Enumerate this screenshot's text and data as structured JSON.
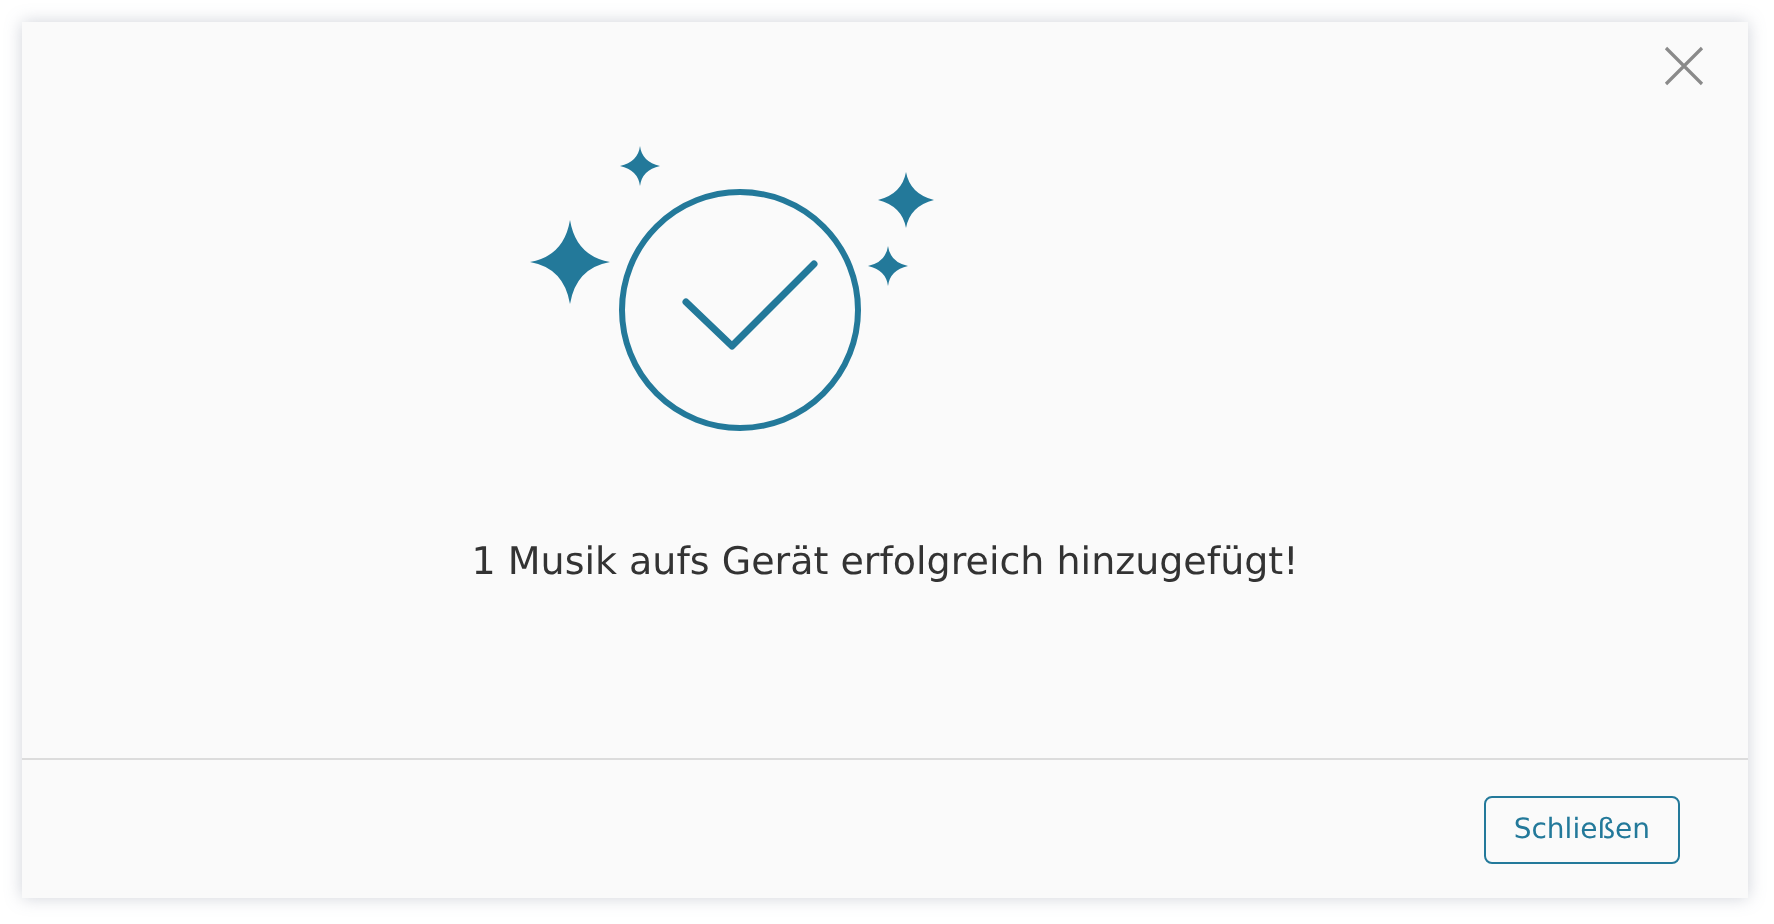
{
  "dialog": {
    "message": "1 Musik aufs Gerät erfolgreich hinzugefügt!",
    "buttons": [
      "Schließen"
    ]
  }
}
